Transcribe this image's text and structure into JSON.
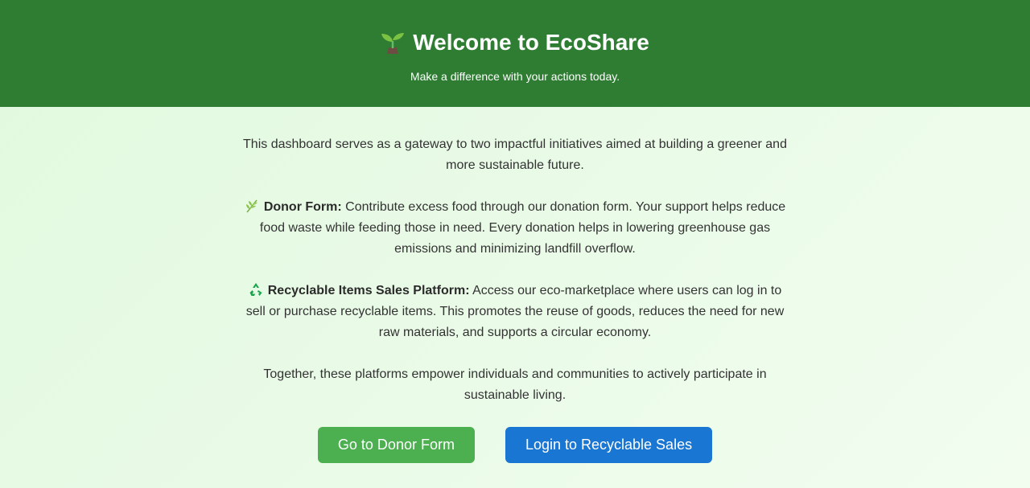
{
  "header": {
    "title": "Welcome to EcoShare",
    "subtitle": "Make a difference with your actions today.",
    "background_color": "#2e7d32",
    "title_icon": "seedling-icon"
  },
  "main": {
    "intro": "This dashboard serves as a gateway to two impactful initiatives aimed at building a greener and more sustainable future.",
    "donor": {
      "icon": "herb-icon",
      "label": "Donor Form:",
      "text": " Contribute excess food through our donation form. Your support helps reduce food waste while feeding those in need. Every donation helps in lowering greenhouse gas emissions and minimizing landfill overflow."
    },
    "recycle": {
      "icon": "recycle-icon",
      "label": "Recyclable Items Sales Platform:",
      "text": " Access our eco-marketplace where users can log in to sell or purchase recyclable items. This promotes the reuse of goods, reduces the need for new raw materials, and supports a circular economy."
    },
    "closing": "Together, these platforms empower individuals and communities to actively participate in sustainable living."
  },
  "buttons": {
    "donor_label": "Go to Donor Form",
    "donor_color": "#4caf50",
    "recycle_label": "Login to Recyclable Sales",
    "recycle_color": "#1976d2"
  }
}
